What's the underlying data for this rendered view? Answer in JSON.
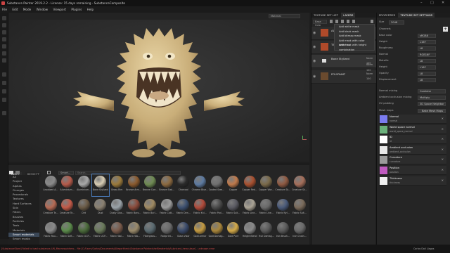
{
  "titlebar": {
    "title": "Substance Painter 2019.2.2 - License: 15 days remaining - SubstanceComposite"
  },
  "menu": [
    "File",
    "Edit",
    "Mode",
    "Window",
    "Viewport",
    "Plugins",
    "Help"
  ],
  "viewport": {
    "material_select": "Material"
  },
  "shelf": {
    "tabs": [
      "SHELF",
      "PROJECT"
    ],
    "search_filter": "Smart...",
    "search_placeholder": "Search...",
    "categories": [
      "All",
      "Project",
      "Alphas",
      "Grunges",
      "Procedurals",
      "Textures",
      "Hard Surfaces",
      "Skin",
      "Filters",
      "Brushes",
      "Particles",
      "Tools",
      "Materials",
      "Smart materials",
      "Smart masks"
    ],
    "active_category": "Smart materials",
    "materials": [
      {
        "label": "Anodized A...",
        "color": "#8a8a8a"
      },
      {
        "label": "Aluminium...",
        "color": "#b55a4a"
      },
      {
        "label": "Aluminium...",
        "color": "#a8a8a8"
      },
      {
        "label": "Bone Stylized",
        "color": "#d8cdb4"
      },
      {
        "label": "Brass Rim",
        "color": "#9b7a3b"
      },
      {
        "label": "Bronze Arm...",
        "color": "#8a5a2e"
      },
      {
        "label": "Bronze Corr...",
        "color": "#6e8a52"
      },
      {
        "label": "Bronze Stat...",
        "color": "#8c6a40"
      },
      {
        "label": "Charcoal",
        "color": "#2a2a2a"
      },
      {
        "label": "Chrome Blue...",
        "color": "#5d7aa0"
      },
      {
        "label": "Coated Stee...",
        "color": "#707070"
      },
      {
        "label": "Copper",
        "color": "#c07a4c"
      },
      {
        "label": "Copper Red...",
        "color": "#a8502f"
      },
      {
        "label": "Copper Wor...",
        "color": "#7a6a4a"
      },
      {
        "label": "Creature Sk...",
        "color": "#8f5a42"
      },
      {
        "label": "Creature Sk...",
        "color": "#a46e5a"
      },
      {
        "label": "Creature Te...",
        "color": "#b66b55"
      },
      {
        "label": "Creature Te...",
        "color": "#c45a48"
      },
      {
        "label": "Dirt",
        "color": "#6a5a45"
      },
      {
        "label": "Dust",
        "color": "#8a8070"
      },
      {
        "label": "Dusty Glas...",
        "color": "#9aa2a8"
      },
      {
        "label": "Fabric Baro...",
        "color": "#8a4a3a"
      },
      {
        "label": "Fabric Burl...",
        "color": "#a08a62"
      },
      {
        "label": "Fabric Cott...",
        "color": "#9a9a9a"
      },
      {
        "label": "Fabric Den...",
        "color": "#3c5070"
      },
      {
        "label": "Fabric Kni...",
        "color": "#b04a3a"
      },
      {
        "label": "Fabric Pad...",
        "color": "#4a4a4a"
      },
      {
        "label": "Fabric Suit...",
        "color": "#5a5a62"
      },
      {
        "label": "Fabric Line...",
        "color": "#aaa394"
      },
      {
        "label": "Fabric Line...",
        "color": "#6a6a6a"
      },
      {
        "label": "Fabric Nyl...",
        "color": "#4a5a7a"
      },
      {
        "label": "Fabric Suit...",
        "color": "#7a6a5a"
      },
      {
        "label": "Fabric Rou...",
        "color": "#8a8a8a"
      },
      {
        "label": "Fabric Soft...",
        "color": "#5a8a4a"
      },
      {
        "label": "Fabric UCP...",
        "color": "#4a6a3a"
      },
      {
        "label": "Fabric UCP...",
        "color": "#6a7a5a"
      },
      {
        "label": "Fabric Wol...",
        "color": "#7a5a4a"
      },
      {
        "label": "Fabric Wo...",
        "color": "#9a8a6a"
      },
      {
        "label": "Fiberglass...",
        "color": "#5a6a70"
      },
      {
        "label": "Footprint...",
        "color": "#6a6a6a"
      },
      {
        "label": "Glass Visor",
        "color": "#3a4a6a"
      },
      {
        "label": "Gold Armor",
        "color": "#c49a40"
      },
      {
        "label": "Gold Damag...",
        "color": "#a8853a"
      },
      {
        "label": "Gold Pure",
        "color": "#d4aa48"
      },
      {
        "label": "Height Blend",
        "color": "#8a8a8a"
      },
      {
        "label": "Hull Damag...",
        "color": "#5a5a5a"
      },
      {
        "label": "Iron Brush...",
        "color": "#5a5a5a"
      },
      {
        "label": "Iron Chain...",
        "color": "#6a6a6a"
      }
    ]
  },
  "texture_set_list": {
    "tabs": [
      "TEXTURE SET LIST",
      "LAYERS"
    ],
    "channel_select": "Base Colo",
    "norm_select": "Norm",
    "layers": [
      {
        "name": "ALPH",
        "sub": "Norm",
        "value": "100"
      },
      {
        "name": "TEXT",
        "sub": "Norm",
        "value": "100"
      },
      {
        "name": "Bone Stylized",
        "sub": "Norm",
        "value": "100"
      },
      {
        "name": "POLYPAINT",
        "sub": "Norm",
        "value": "100"
      }
    ],
    "context_menu": [
      "Add white mask",
      "Add black mask",
      "Add bitmap mask",
      "Add mask with color selection",
      "Add mask with height combination"
    ]
  },
  "properties": {
    "tabs": [
      "PROPERTIES",
      "TEXTURE SET SETTINGS"
    ],
    "size_label": "Size",
    "size_value": "2048",
    "rows": [
      {
        "label": "Channels",
        "value": ""
      },
      {
        "label": "Base color",
        "value": "sRGB8"
      },
      {
        "label": "Height",
        "value": "L16F"
      },
      {
        "label": "Roughness",
        "value": "L8"
      },
      {
        "label": "Normal",
        "value": "RGB16F"
      },
      {
        "label": "Metallic",
        "value": "L8"
      },
      {
        "label": "Height",
        "value": "L16F"
      },
      {
        "label": "Opacity",
        "value": "L8"
      },
      {
        "label": "Displacement",
        "value": "L8"
      }
    ],
    "normal_mixing_label": "Normal mixing",
    "normal_mixing_value": "Combine",
    "ao_mixing_label": "Ambient occlusion mixing",
    "ao_mixing_value": "Multiply",
    "uv_padding_label": "UV padding",
    "uv_padding_value": "3D Space Neighbor",
    "mesh_maps_label": "Mesh maps",
    "bake_button": "Bake Mesh Maps",
    "mesh_maps": [
      {
        "name": "Normal",
        "value": "normal",
        "color": "#7b7cf0"
      },
      {
        "name": "World space normal",
        "value": "world_space_normal",
        "color": "#6ab07a"
      },
      {
        "name": "ID",
        "value": "id",
        "color": "#ffffff"
      },
      {
        "name": "Ambient occlusion",
        "value": "ambient_occlusion",
        "color": "#e8e8e8"
      },
      {
        "name": "Curvature",
        "value": "curvature",
        "color": "#9a9a9a"
      },
      {
        "name": "Position",
        "value": "position",
        "color": "#c05ac0"
      },
      {
        "name": "Thickness",
        "value": "thickness",
        "color": "#f0f0f0"
      }
    ]
  },
  "status": {
    "message": "[SubstanceStore] Failed to load substance_UN_Mannequinhero... file [C:/Users/Carlos/Documents/Allegorithmic/Substance Painter/shelf/materials/Lubricant_hero.sbsar] - unknown error",
    "user": "Carlos Dali Llagas"
  }
}
